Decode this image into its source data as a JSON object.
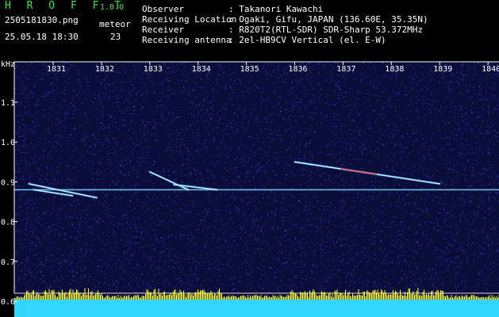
{
  "header": {
    "app_title": "H R O F F T",
    "app_version": "1.0.0",
    "file_name": "2505181830.png",
    "timestamp": "25.05.18 18:30",
    "count_label": "meteor",
    "count_value": "23",
    "info_labels": "Observer\nReceiving Location\nReceiver\nReceiving antenna",
    "info_values": ": Takanori Kawachi\n: Ogaki, Gifu, JAPAN (136.60E, 35.35N)\n: R820T2(RTL-SDR) SDR-Sharp 53.372MHz\n: 2el-HB9CV Vertical (el. E-W)"
  },
  "chart_data": {
    "type": "heatmap",
    "ylabel": "kHz",
    "x_ticks": [
      "1831",
      "1832",
      "1833",
      "1834",
      "1835",
      "1836",
      "1837",
      "1838",
      "1839",
      "1840"
    ],
    "y_ticks": [
      "1.1",
      "1.0",
      "0.9",
      "0.8",
      "0.7",
      "0.6"
    ],
    "x_range": [
      "1830:15",
      "1840:20"
    ],
    "y_range": [
      0.58,
      1.2
    ],
    "carrier_khz": 0.88,
    "reference_lines_khz": [
      0.62,
      0.598
    ],
    "traces": [
      {
        "start": 1830.5,
        "end": 1831.9,
        "f_start": 0.895,
        "f_end": 0.86
      },
      {
        "start": 1830.6,
        "end": 1831.4,
        "f_start": 0.88,
        "f_end": 0.865
      },
      {
        "start": 1833.0,
        "end": 1833.8,
        "f_start": 0.925,
        "f_end": 0.88
      },
      {
        "start": 1833.5,
        "end": 1834.4,
        "f_start": 0.893,
        "f_end": 0.88
      },
      {
        "start": 1836.0,
        "end": 1839.0,
        "f_start": 0.95,
        "f_end": 0.895
      }
    ],
    "colors": {
      "background": "#0a0c3a",
      "noise": "#2a3cc8",
      "carrier": "#7fd8ff",
      "trace": "#c8ffff",
      "trace_hot": "#ff4040",
      "bars_top": "#ffff33",
      "bars_base": "#33d6ff",
      "axis": "#ffffff"
    },
    "grid": false
  }
}
